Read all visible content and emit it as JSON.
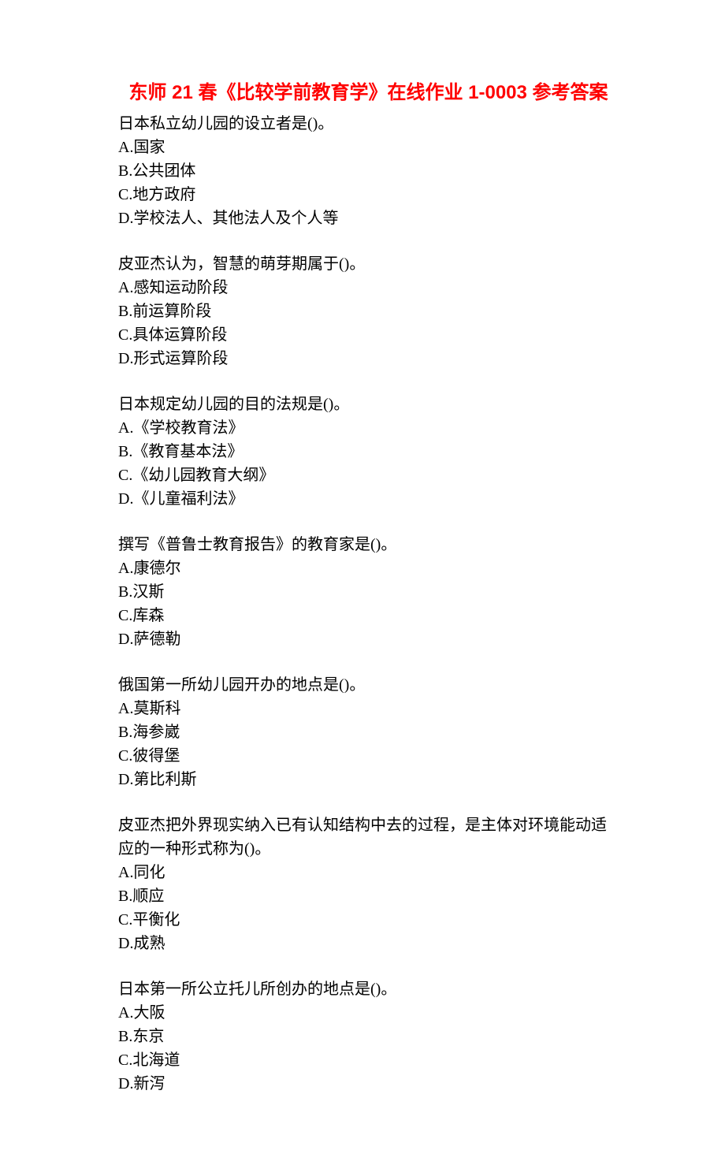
{
  "title": "东师 21 春《比较学前教育学》在线作业 1-0003 参考答案",
  "questions": [
    {
      "text": "日本私立幼儿园的设立者是()。",
      "options": [
        "A.国家",
        "B.公共团体",
        "C.地方政府",
        "D.学校法人、其他法人及个人等"
      ]
    },
    {
      "text": "皮亚杰认为，智慧的萌芽期属于()。",
      "options": [
        "A.感知运动阶段",
        "B.前运算阶段",
        "C.具体运算阶段",
        "D.形式运算阶段"
      ]
    },
    {
      "text": "日本规定幼儿园的目的法规是()。",
      "options": [
        "A.《学校教育法》",
        "B.《教育基本法》",
        "C.《幼儿园教育大纲》",
        "D.《儿童福利法》"
      ]
    },
    {
      "text": "撰写《普鲁士教育报告》的教育家是()。",
      "options": [
        "A.康德尔",
        "B.汉斯",
        "C.库森",
        "D.萨德勒"
      ]
    },
    {
      "text": "俄国第一所幼儿园开办的地点是()。",
      "options": [
        "A.莫斯科",
        "B.海参崴",
        "C.彼得堡",
        "D.第比利斯"
      ]
    },
    {
      "text": "皮亚杰把外界现实纳入已有认知结构中去的过程，是主体对环境能动适应的一种形式称为()。",
      "options": [
        "A.同化",
        "B.顺应",
        "C.平衡化",
        "D.成熟"
      ]
    },
    {
      "text": "日本第一所公立托儿所创办的地点是()。",
      "options": [
        "A.大阪",
        "B.东京",
        "C.北海道",
        "D.新泻"
      ]
    }
  ]
}
